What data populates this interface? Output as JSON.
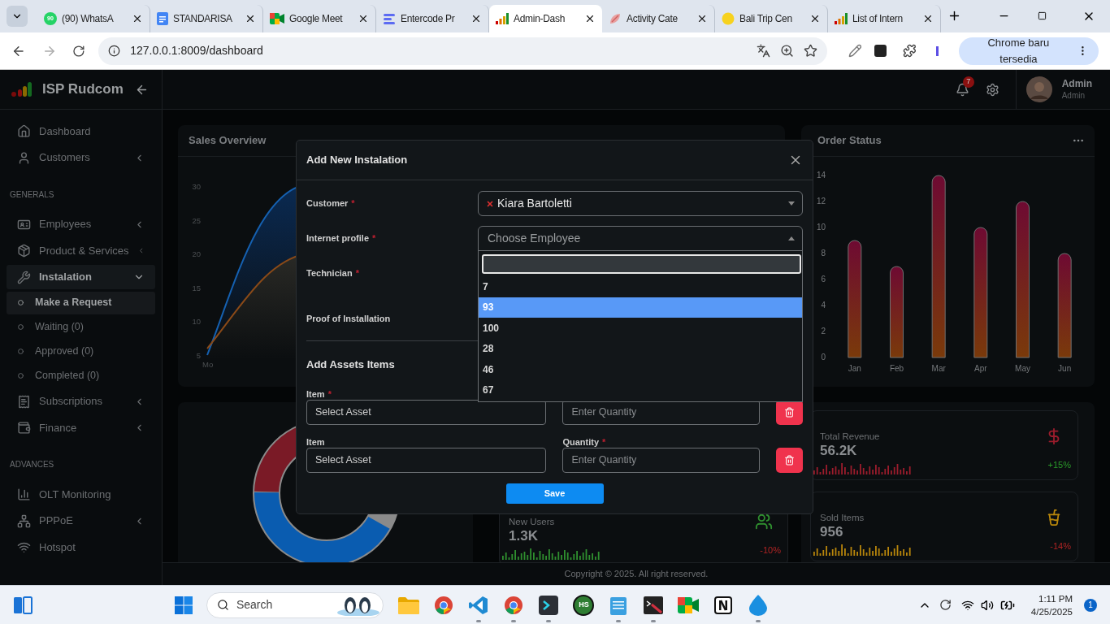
{
  "browser": {
    "tabs": [
      {
        "title": "(90) WhatsA",
        "kind": "whatsapp",
        "badge": "90",
        "selected": false
      },
      {
        "title": "STANDARISA",
        "kind": "docs",
        "selected": false
      },
      {
        "title": "Google Meet",
        "kind": "meet",
        "selected": false
      },
      {
        "title": "Entercode Pr",
        "kind": "entercode",
        "selected": false
      },
      {
        "title": "Admin-Dash",
        "kind": "bars",
        "selected": true
      },
      {
        "title": "Activity Cate",
        "kind": "activity",
        "selected": false
      },
      {
        "title": "Bali Trip Cen",
        "kind": "smile",
        "selected": false
      },
      {
        "title": "List of Intern",
        "kind": "bars",
        "selected": false
      }
    ],
    "address": "127.0.0.1:8009/dashboard",
    "update_label": "Chrome baru tersedia"
  },
  "brand": "ISP Rudcom",
  "sidebar": [
    {
      "items": [
        {
          "label": "Dashboard",
          "kind": "home"
        },
        {
          "label": "Customers",
          "kind": "user",
          "expanded": false
        }
      ]
    },
    {
      "heading": "GENERALS",
      "items": [
        {
          "label": "Employees",
          "kind": "idcard",
          "expanded": false
        },
        {
          "label": "Product & Services",
          "kind": "package",
          "expanded": false
        },
        {
          "label": "Instalation",
          "kind": "wrench",
          "expanded": true,
          "children": [
            {
              "label": "Make a Request",
              "selected": true
            },
            {
              "label": "Waiting (0)",
              "selected": false
            },
            {
              "label": "Approved (0)",
              "selected": false
            },
            {
              "label": "Completed (0)",
              "selected": false
            }
          ]
        },
        {
          "label": "Subscriptions",
          "kind": "receipt",
          "expanded": false
        },
        {
          "label": "Finance",
          "kind": "wallet",
          "expanded": false
        }
      ]
    },
    {
      "heading": "ADVANCES",
      "items": [
        {
          "label": "OLT Monitoring",
          "kind": "chart"
        },
        {
          "label": "PPPoE",
          "kind": "network",
          "expanded": false
        },
        {
          "label": "Hotspot",
          "kind": "wifi"
        }
      ]
    }
  ],
  "header": {
    "notifications": "7",
    "user_name": "Admin",
    "user_role": "Admin"
  },
  "sales_overview": {
    "title": "Sales Overview",
    "y_ticks": [
      "30",
      "25",
      "20",
      "15",
      "10",
      "5"
    ],
    "x_label": "Mo"
  },
  "order_status": {
    "title": "Order Status",
    "chart_data": {
      "type": "bar",
      "categories": [
        "Jan",
        "Feb",
        "Mar",
        "Apr",
        "May",
        "Jun"
      ],
      "values": [
        9,
        7,
        14,
        10,
        12,
        8
      ],
      "yticks": [
        0,
        2,
        4,
        6,
        8,
        10,
        12,
        14
      ],
      "ylim": [
        0,
        14
      ]
    }
  },
  "stats_middle": [
    {
      "label": "New Users",
      "value": "1.3K",
      "change": "-10%",
      "rising": false,
      "kind": "users",
      "color": "#2f8f2f"
    }
  ],
  "stats_right": [
    {
      "label": "Total Revenue",
      "value": "56.2K",
      "change": "+15%",
      "rising": true,
      "kind": "dollar",
      "color": "#9b1c2c"
    },
    {
      "label": "Sold Items",
      "value": "956",
      "change": "-14%",
      "rising": false,
      "kind": "cup",
      "color": "#b8860b"
    }
  ],
  "footer": "Copyright © 2025. All right reserved.",
  "modal": {
    "title": "Add New Instalation",
    "fields": [
      {
        "label": "Customer",
        "required_mark": "*",
        "kind": "tag-select",
        "value": "Kiara Bartoletti"
      },
      {
        "label": "Internet profile",
        "required_mark": "*",
        "kind": "open-select",
        "placeholder": "Choose Employee"
      },
      {
        "label": "Technician",
        "required_mark": "*",
        "kind": "covered"
      },
      {
        "label": "Proof of Installation",
        "kind": "covered-tall"
      }
    ],
    "dropdown": [
      {
        "label": "7",
        "selected": false
      },
      {
        "label": "93",
        "selected": true
      },
      {
        "label": "100",
        "selected": false
      },
      {
        "label": "28",
        "selected": false
      },
      {
        "label": "46",
        "selected": false
      },
      {
        "label": "67",
        "selected": false
      }
    ],
    "assets_title": "Add Assets Items",
    "asset_rows": [
      {
        "item_label": "Item",
        "item_mark": "*",
        "item_placeholder": "Select Asset",
        "qty_placeholder": "Enter Quantity"
      },
      {
        "item_label": "Item",
        "item_placeholder": "Select Asset",
        "qty_label": "Quantity",
        "qty_mark": "*",
        "qty_placeholder": "Enter Quantity"
      }
    ],
    "save": "Save"
  },
  "taskbar": {
    "search_placeholder": "Search",
    "apps": [
      {
        "kind": "folder",
        "running": false
      },
      {
        "kind": "chrome",
        "running": false
      },
      {
        "kind": "vscode",
        "running": true
      },
      {
        "kind": "chrome-profile",
        "running": true
      },
      {
        "kind": "terminal",
        "running": true
      },
      {
        "kind": "hs",
        "label": "HS",
        "running": false
      },
      {
        "kind": "notepad",
        "running": true
      },
      {
        "kind": "console",
        "running": true
      },
      {
        "kind": "meet",
        "running": false
      },
      {
        "kind": "notion",
        "running": false
      },
      {
        "kind": "drop",
        "running": true
      }
    ],
    "time": "1:11 PM",
    "date": "4/25/2025",
    "notification_count": "1"
  }
}
